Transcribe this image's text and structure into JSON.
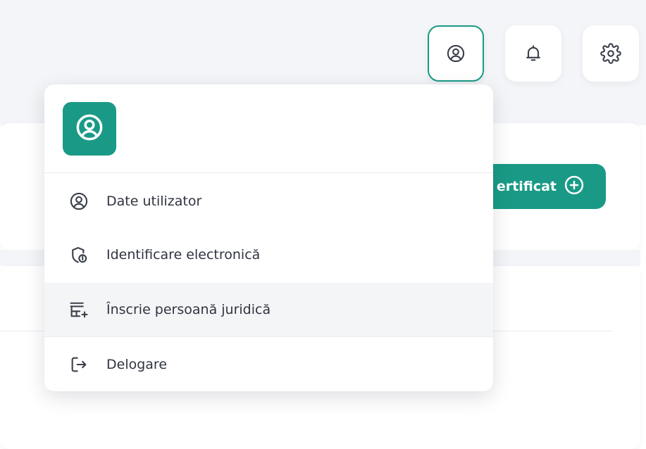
{
  "topbar": {
    "icons": [
      {
        "name": "user-circle-icon",
        "active": true
      },
      {
        "name": "bell-icon",
        "active": false
      },
      {
        "name": "gear-icon",
        "active": false
      }
    ]
  },
  "background": {
    "add_certificate_label": "ertificat",
    "add_certificate_icon": "plus-circle-icon"
  },
  "user_menu": {
    "avatar_icon": "user-circle-icon",
    "items": [
      {
        "label": "Date utilizator",
        "icon": "user-circle-icon"
      },
      {
        "label": "Identificare electronică",
        "icon": "shield-info-icon"
      },
      {
        "label": "Înscrie persoană juridică",
        "icon": "store-add-icon"
      },
      {
        "label": "Delogare",
        "icon": "logout-icon"
      }
    ],
    "highlighted_index": 2
  },
  "colors": {
    "accent": "#1a9a86",
    "page_bg": "#f3f5f8",
    "text": "#2f3440",
    "icon": "#3a3f4a"
  }
}
